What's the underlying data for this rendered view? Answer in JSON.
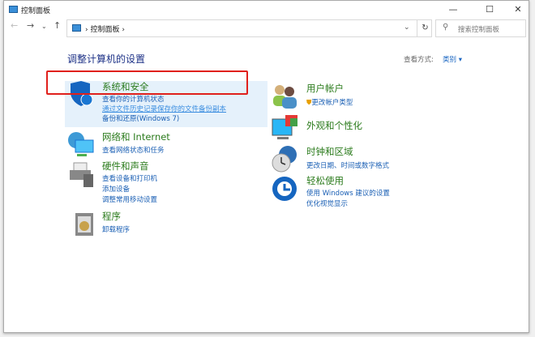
{
  "window": {
    "title": "控制面板",
    "minimize": "—",
    "maximize": "☐",
    "close": "✕"
  },
  "nav": {
    "back": "←",
    "forward": "→",
    "recent": "⌄",
    "up": "↑"
  },
  "address": {
    "crumb": "控制面板",
    "sep": "›",
    "dropdown": "⌄",
    "refresh": "↻"
  },
  "search": {
    "placeholder": "搜索控制面板",
    "icon": "⚲"
  },
  "main": {
    "heading": "调整计算机的设置",
    "view_by_label": "查看方式:",
    "view_by_value": "类别 ▾"
  },
  "categories": [
    {
      "name": "系统和安全",
      "icon": "shield-icon",
      "links": [
        "查看你的计算机状态",
        "通过文件历史记录保存你的文件备份副本",
        "备份和还原(Windows 7)"
      ]
    },
    {
      "name": "网络和 Internet",
      "icon": "network-icon",
      "links": [
        "查看网络状态和任务"
      ]
    },
    {
      "name": "硬件和声音",
      "icon": "printer-icon",
      "links": [
        "查看设备和打印机",
        "添加设备",
        "调整常用移动设置"
      ]
    },
    {
      "name": "程序",
      "icon": "programs-icon",
      "links": [
        "卸载程序"
      ]
    },
    {
      "name": "用户帐户",
      "icon": "users-icon",
      "links": [
        "更改帐户类型"
      ]
    },
    {
      "name": "外观和个性化",
      "icon": "appearance-icon",
      "links": []
    },
    {
      "name": "时钟和区域",
      "icon": "clock-icon",
      "links": [
        "更改日期、时间或数字格式"
      ]
    },
    {
      "name": "轻松使用",
      "icon": "ease-of-access-icon",
      "links": [
        "使用 Windows 建议的设置",
        "优化视觉显示"
      ]
    }
  ],
  "colors": {
    "category": "#2b7b1c",
    "link": "#1a5fb4",
    "highlight": "#e5f1fb",
    "annotation": "#e0201c"
  }
}
